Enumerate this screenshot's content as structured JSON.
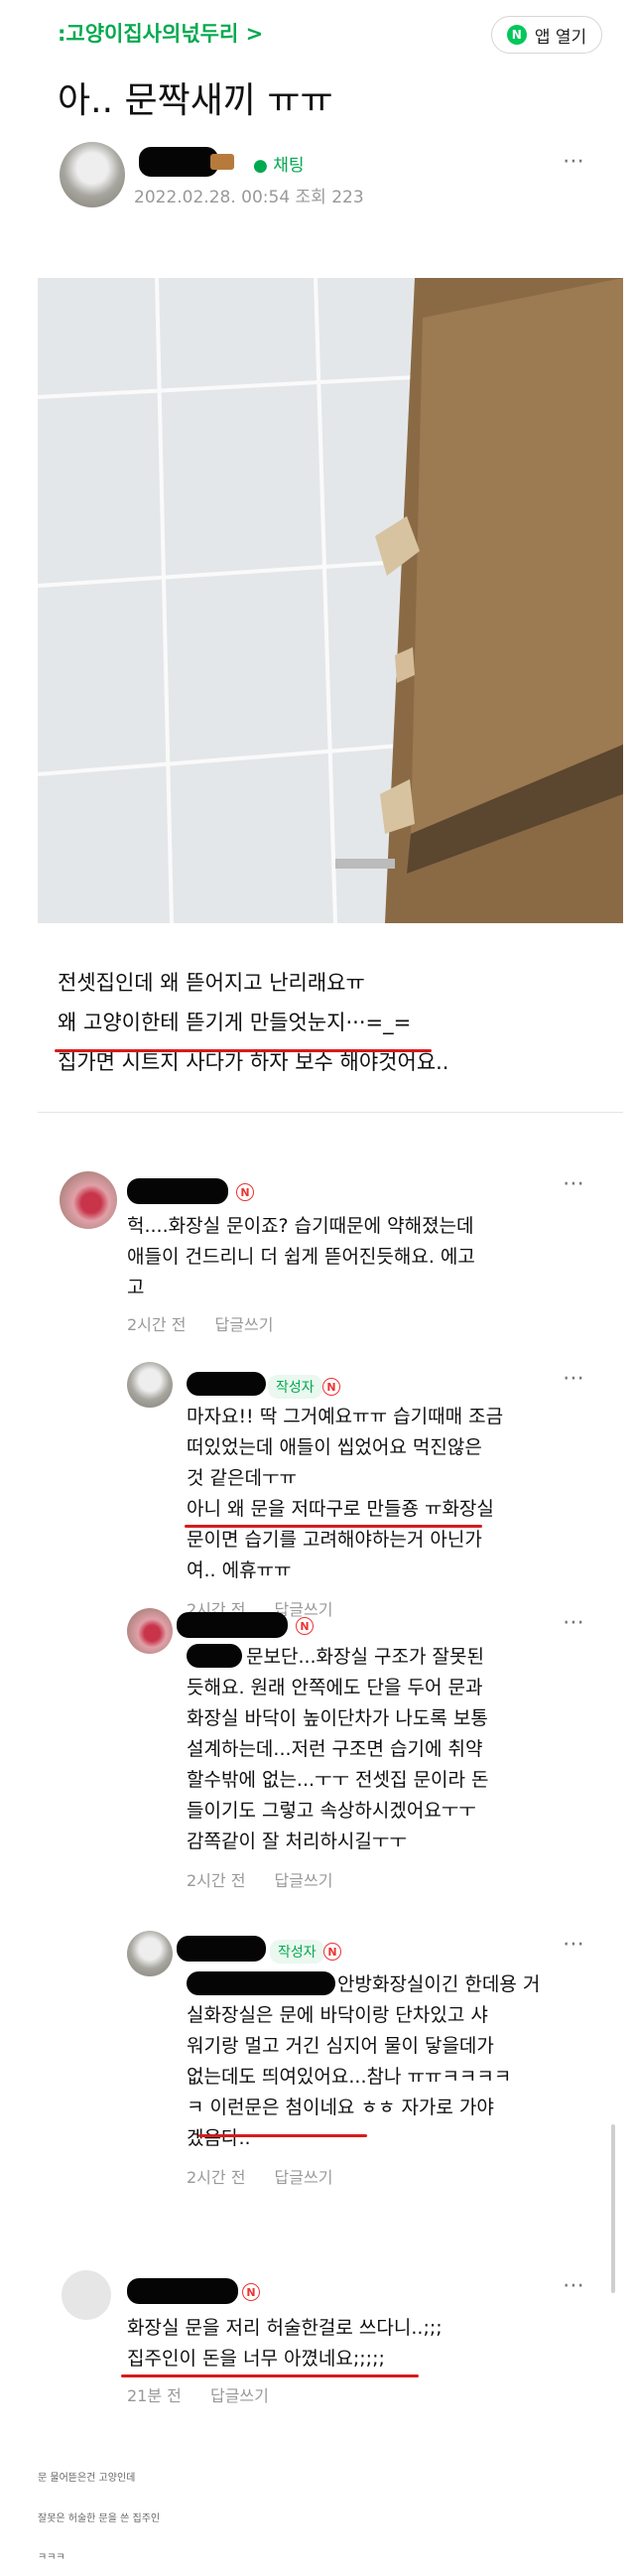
{
  "header": {
    "cafe_name": ":고양이집사의넋두리 >",
    "app_button_label": "앱 열기",
    "app_icon": "N"
  },
  "post": {
    "title": "아.. 문짝새끼 ㅠㅠ",
    "chat_label": "채팅",
    "date": "2022.02.28. 00:54",
    "views": "조회 223",
    "body_lines": [
      "전셋집인데 왜 뜯어지고 난리래요ㅠ",
      "왜 고양이한테 뜯기게 만들엇눈지···=_=",
      "집가면 시트지 사다가 하자 보수 해야것어요.."
    ]
  },
  "comments": [
    {
      "text_lines": [
        "헉....화장실 문이죠? 습기때문에 약해졌는데",
        "애들이 건드리니 더 쉽게 뜯어진듯해요. 에고",
        "고"
      ],
      "time": "2시간 전",
      "reply": "답글쓰기"
    },
    {
      "author_badge": "작성자",
      "text_lines": [
        "마자요!! 딱 그거예요ㅠㅠ 습기때매 조금",
        "떠있었는데 애들이 씹었어요 먹진않은",
        "것 같은데ㅜㅠ",
        "아니 왜 문을 저따구로 만들죵 ㅠ화장실",
        "문이면 습기를 고려해야하는거 아닌가",
        "여.. 에휴ㅠㅠ"
      ],
      "time": "2시간 전",
      "reply": "답글쓰기"
    },
    {
      "text_lines": [
        "문보단...화장실 구조가 잘못된",
        "듯해요. 원래 안쪽에도 단을 두어 문과",
        "화장실 바닥이 높이단차가 나도록 보통",
        "설계하는데...저런 구조면 습기에 취약",
        "할수밖에 없는...ㅜㅜ 전셋집 문이라 돈",
        "들이기도 그렇고 속상하시겠어요ㅜㅜ",
        "감쪽같이 잘 처리하시길ㅜㅜ"
      ],
      "time": "2시간 전",
      "reply": "답글쓰기"
    },
    {
      "author_badge": "작성자",
      "text_lines": [
        "안방화장실이긴 한데용 거",
        "실화장실은 문에 바닥이랑 단차있고 샤",
        "워기랑 멀고 거긴 심지어 물이 닿을데가",
        "없는데도 띄여있어요...참나 ㅠㅠㅋㅋㅋㅋ",
        "ㅋ 이런문은 첨이네요 ㅎㅎ 자가로 가야",
        "겠음다.."
      ],
      "time": "2시간 전",
      "reply": "답글쓰기"
    },
    {
      "text_lines": [
        "화장실 문을 저리 허술한걸로 쓰다니..;;;",
        "집주인이 돈을 너무 아꼈네요;;;;;"
      ],
      "time": "21분 전",
      "reply": "답글쓰기"
    }
  ],
  "footnotes": [
    "문 물어뜯은건 고양인데",
    "잘못은 허술한 문을 쓴 집주인",
    "ㅋㅋㅋ"
  ],
  "colors": {
    "accent": "#03a94f",
    "underline": "#d81b1b",
    "badge": "#ee3333"
  },
  "icons": [
    "chat-bubble-icon",
    "more-options-icon",
    "naver-n-icon"
  ]
}
